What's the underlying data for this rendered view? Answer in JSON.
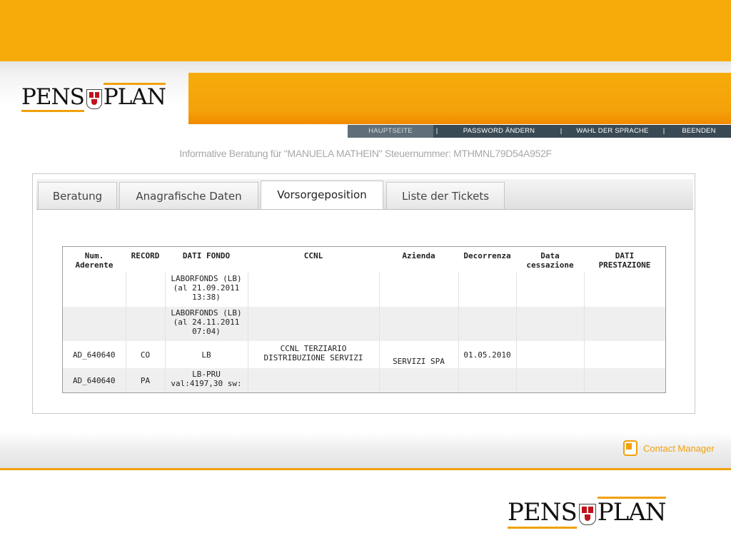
{
  "header": {
    "logo_left": "PENS",
    "logo_right": "PLAN"
  },
  "nav": {
    "items": [
      "HAUPTSEITE",
      "PASSWORD ÄNDERN",
      "WAHL DER SPRACHE",
      "BEENDEN"
    ],
    "separator": "|"
  },
  "subtitle": "Informative Beratung für \"MANUELA MATHEIN\" Steuernummer: MTHMNL79D54A952F",
  "tabs": [
    "Beratung",
    "Anagrafische Daten",
    "Vorsorgeposition",
    "Liste der Tickets"
  ],
  "active_tab": "Vorsorgeposition",
  "table": {
    "headers": {
      "num_line1": "Num.",
      "num_line2": "Aderente",
      "record": "RECORD",
      "dati_fondo": "DATI FONDO",
      "ccnl": "CCNL",
      "azienda": "Azienda",
      "decorrenza": "Decorrenza",
      "data_line1": "Data",
      "data_line2": "cessazione",
      "prest_line1": "DATI",
      "prest_line2": "PRESTAZIONE"
    },
    "rows": [
      {
        "num": "",
        "record": "",
        "fondo_1": "LABORFONDS (LB)",
        "fondo_2": "(al 21.09.2011",
        "fondo_3": "13:38)",
        "ccnl_1": "",
        "ccnl_2": "",
        "azienda": "",
        "decorrenza": "",
        "cessazione": "",
        "prestazione": ""
      },
      {
        "num": "",
        "record": "",
        "fondo_1": "LABORFONDS (LB)",
        "fondo_2": "(al 24.11.2011",
        "fondo_3": "07:04)",
        "ccnl_1": "",
        "ccnl_2": "",
        "azienda": "",
        "decorrenza": "",
        "cessazione": "",
        "prestazione": ""
      },
      {
        "num": "AD_640640",
        "record": "CO",
        "fondo_1": "LB",
        "fondo_2": "",
        "fondo_3": "",
        "ccnl_1": "CCNL TERZIARIO",
        "ccnl_2": "DISTRIBUZIONE SERVIZI",
        "azienda": "SERVIZI SPA",
        "decorrenza": "01.05.2010",
        "cessazione": "",
        "prestazione": ""
      },
      {
        "num": "AD_640640",
        "record": "PA",
        "fondo_1": "LB-PRU",
        "fondo_2": "val:4197,30 sw:",
        "fondo_3": "",
        "ccnl_1": "",
        "ccnl_2": "",
        "azienda": "",
        "decorrenza": "",
        "cessazione": "",
        "prestazione": ""
      }
    ]
  },
  "footer": {
    "contact_label": "Contact Manager"
  },
  "colors": {
    "brand_orange": "#f7ab0a",
    "nav_dark": "#3a4a54"
  },
  "icons": {
    "contact": "contact-manager-icon",
    "coat_of_arms": "coat-of-arms-icon"
  }
}
